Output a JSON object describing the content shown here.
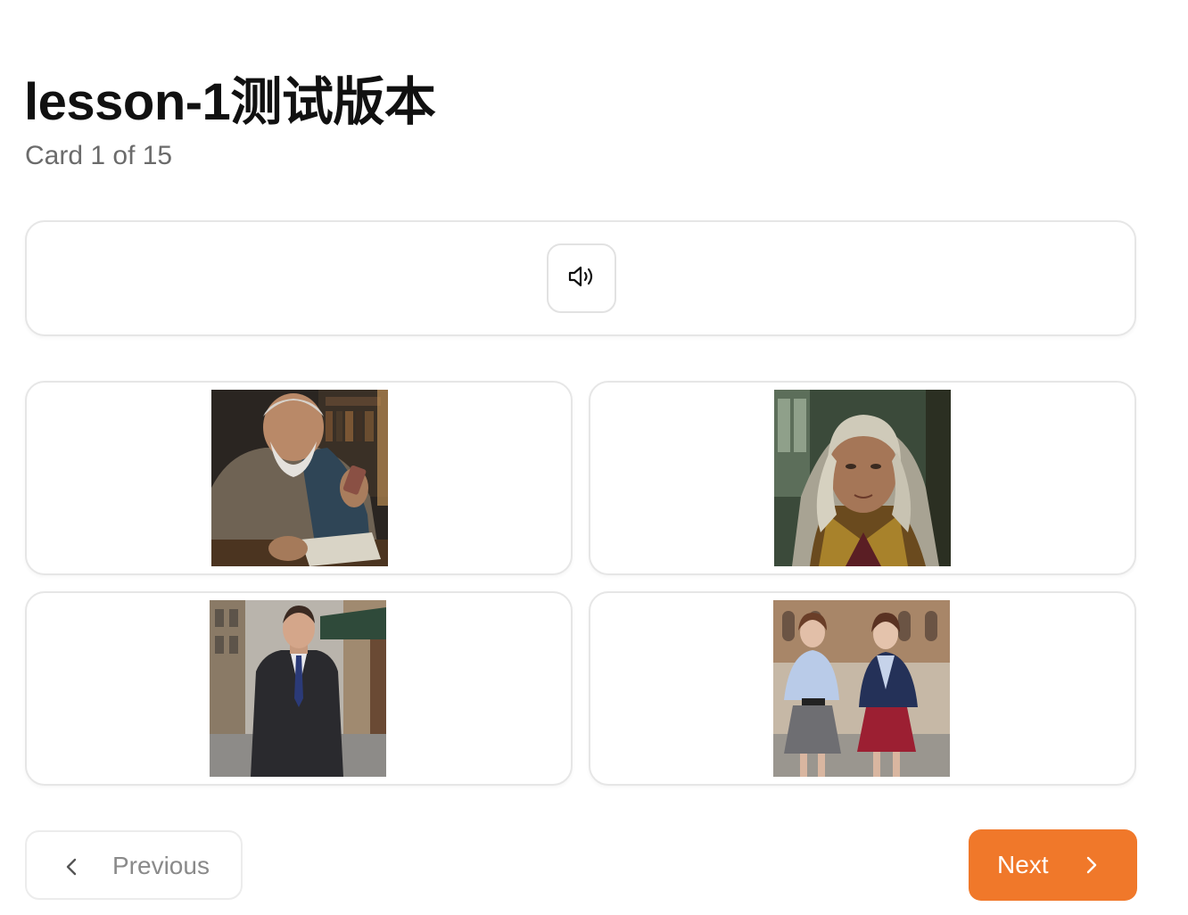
{
  "lesson": {
    "title": "lesson-1测试版本",
    "progress_text": "Card 1 of 15"
  },
  "audio": {
    "icon": "speaker-volume-icon"
  },
  "options": [
    {
      "picture": "elderly-man-writing-at-desk-image"
    },
    {
      "picture": "elderly-woman-portrait-image"
    },
    {
      "picture": "man-in-suit-on-street-image"
    },
    {
      "picture": "two-women-in-school-uniforms-image"
    }
  ],
  "navigation": {
    "previous_label": "Previous",
    "next_label": "Next",
    "previous_icon": "chevron-left-icon",
    "next_icon": "chevron-right-icon"
  },
  "colors": {
    "accent": "#f0782a",
    "border": "#e6e6e6",
    "muted_text": "#6b6b6b"
  }
}
